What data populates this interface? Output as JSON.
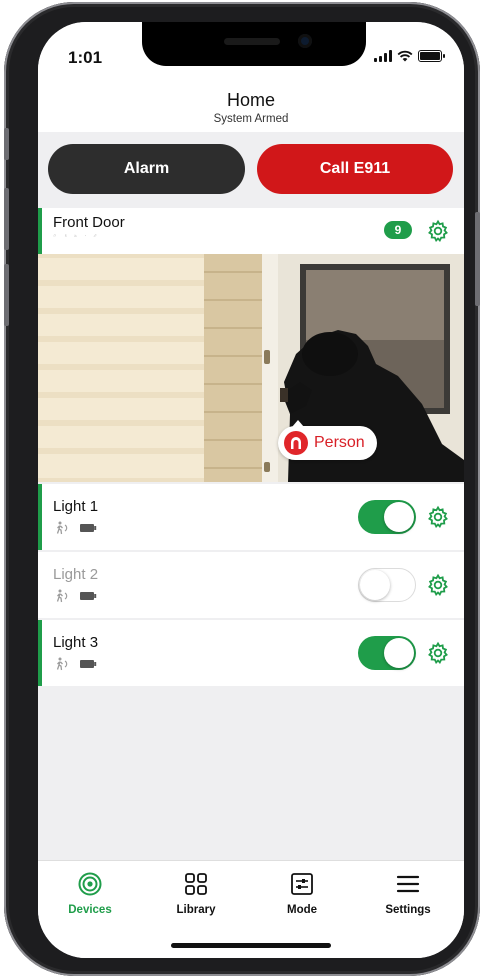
{
  "status_bar": {
    "time": "1:01"
  },
  "header": {
    "title": "Home",
    "subtitle": "System Armed"
  },
  "actions": {
    "alarm_label": "Alarm",
    "call_label": "Call E911"
  },
  "camera_card": {
    "name": "Front Door",
    "badge_count": "9",
    "detection_label": "Person",
    "status_icons": [
      "hearing-icon",
      "motion-icon",
      "wifi-signal-icon",
      "battery-icon",
      "tag-icon"
    ]
  },
  "lights": [
    {
      "name": "Light 1",
      "on": true
    },
    {
      "name": "Light 2",
      "on": false
    },
    {
      "name": "Light 3",
      "on": true
    }
  ],
  "tabs": [
    {
      "label": "Devices",
      "icon": "devices-icon",
      "active": true
    },
    {
      "label": "Library",
      "icon": "library-grid-icon",
      "active": false
    },
    {
      "label": "Mode",
      "icon": "mode-sliders-icon",
      "active": false
    },
    {
      "label": "Settings",
      "icon": "menu-icon",
      "active": false
    }
  ],
  "colors": {
    "accent": "#1f9d4a",
    "danger": "#d11719",
    "dark": "#2d2d2d",
    "detection": "#e0262a"
  }
}
